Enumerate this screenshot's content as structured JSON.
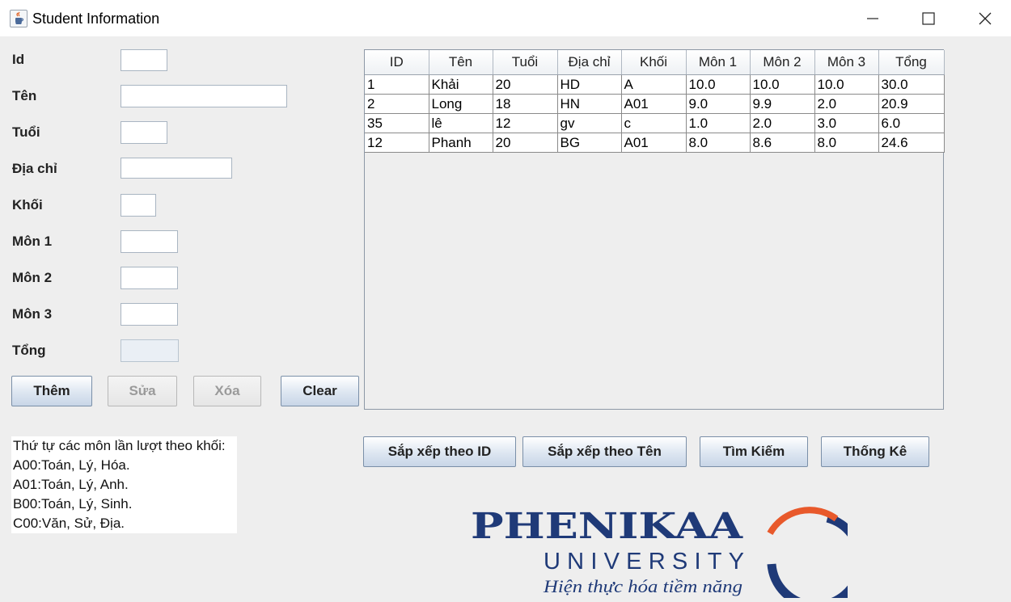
{
  "window": {
    "title": "Student Information",
    "icon": "java-cup-icon"
  },
  "form": {
    "labels": {
      "id": "Id",
      "ten": "Tên",
      "tuoi": "Tuổi",
      "diachi": "Địa chỉ",
      "khoi": "Khối",
      "mon1": "Môn 1",
      "mon2": "Môn 2",
      "mon3": "Môn 3",
      "tong": "Tổng"
    },
    "values": {
      "id": "",
      "ten": "",
      "tuoi": "",
      "diachi": "",
      "khoi": "",
      "mon1": "",
      "mon2": "",
      "mon3": "",
      "tong": ""
    },
    "buttons": {
      "them": "Thêm",
      "sua": "Sửa",
      "xoa": "Xóa",
      "clear": "Clear"
    }
  },
  "table": {
    "columns": [
      "ID",
      "Tên",
      "Tuổi",
      "Địa chỉ",
      "Khối",
      "Môn 1",
      "Môn 2",
      "Môn 3",
      "Tổng"
    ],
    "rows": [
      [
        "1",
        "Khải",
        "20",
        "HD",
        "A",
        "10.0",
        "10.0",
        "10.0",
        "30.0"
      ],
      [
        "2",
        "Long",
        "18",
        "HN",
        "A01",
        "9.0",
        "9.9",
        "2.0",
        "20.9"
      ],
      [
        "35",
        "lê",
        "12",
        "gv",
        "c",
        "1.0",
        "2.0",
        "3.0",
        "6.0"
      ],
      [
        "12",
        "Phanh",
        "20",
        "BG",
        "A01",
        "8.0",
        "8.6",
        "8.0",
        "24.6"
      ]
    ]
  },
  "actions": {
    "sort_id": "Sắp xếp theo ID",
    "sort_name": "Sắp xếp theo Tên",
    "search": "Tìm Kiếm",
    "stats": "Thống Kê"
  },
  "note": {
    "lines": [
      "Thứ tự các môn lần lượt theo khối:",
      "A00:Toán, Lý, Hóa.",
      "A01:Toán, Lý, Anh.",
      "B00:Toán, Lý, Sinh.",
      "C00:Văn, Sử, Địa."
    ]
  },
  "logo": {
    "name": "PHENIKAA",
    "sub": "UNIVERSITY",
    "slogan": "Hiện thực hóa tiềm năng",
    "colors": {
      "navy": "#1f3a78",
      "orange": "#e8592b"
    }
  }
}
